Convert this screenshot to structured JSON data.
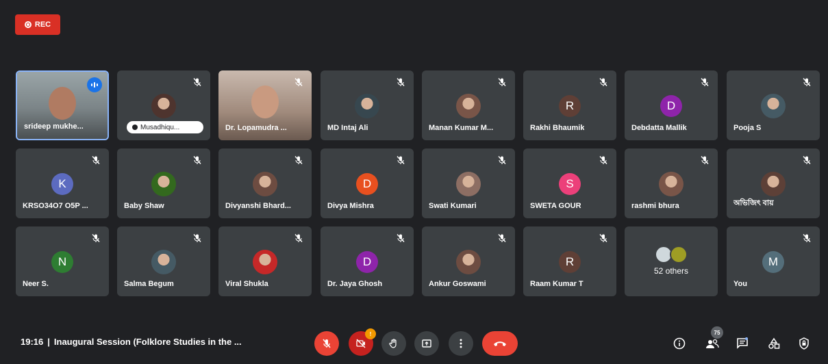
{
  "recording": {
    "label": "REC",
    "color": "#d93025"
  },
  "participants": [
    {
      "name": "srideep mukhe...",
      "kind": "video",
      "speaking": true
    },
    {
      "name": "Musadhiqu...",
      "kind": "photo",
      "pill": true
    },
    {
      "name": "Dr. Lopamudra ...",
      "kind": "video"
    },
    {
      "name": "MD Intaj Ali",
      "kind": "photo"
    },
    {
      "name": "Manan Kumar M...",
      "kind": "photo"
    },
    {
      "name": "Rakhi Bhaumik",
      "kind": "letter",
      "letter": "R",
      "color": "#5f3f36"
    },
    {
      "name": "Debdatta Mallik",
      "kind": "letter",
      "letter": "D",
      "color": "#8e24aa"
    },
    {
      "name": "Pooja S",
      "kind": "photo"
    },
    {
      "name": "KRSO34O7 O5P ...",
      "kind": "letter",
      "letter": "K",
      "color": "#5c6bc0"
    },
    {
      "name": "Baby Shaw",
      "kind": "photo"
    },
    {
      "name": "Divyanshi Bhard...",
      "kind": "photo"
    },
    {
      "name": "Divya Mishra",
      "kind": "letter",
      "letter": "D",
      "color": "#e8501f"
    },
    {
      "name": "Swati Kumari",
      "kind": "photo"
    },
    {
      "name": "SWETA GOUR",
      "kind": "letter",
      "letter": "S",
      "color": "#ec407a"
    },
    {
      "name": "rashmi bhura",
      "kind": "photo"
    },
    {
      "name": "অভিজিৎ বায়",
      "kind": "photo"
    },
    {
      "name": "Neer S.",
      "kind": "letter",
      "letter": "N",
      "color": "#2e7d32"
    },
    {
      "name": "Salma Begum",
      "kind": "photo"
    },
    {
      "name": "Viral Shukla",
      "kind": "photo"
    },
    {
      "name": "Dr. Jaya Ghosh",
      "kind": "letter",
      "letter": "D",
      "color": "#8e24aa"
    },
    {
      "name": "Ankur Goswami",
      "kind": "photo"
    },
    {
      "name": "Raam Kumar T",
      "kind": "letter",
      "letter": "R",
      "color": "#5f3f36"
    },
    {
      "name": "",
      "kind": "others",
      "others_label": "52 others"
    },
    {
      "name": "You",
      "kind": "letter",
      "letter": "M",
      "color": "#546e7a"
    }
  ],
  "bottom": {
    "time": "19:16",
    "meeting_title": "Inaugural Session (Folklore Studies in the ...",
    "camera_badge": "!",
    "people_count": "75"
  }
}
